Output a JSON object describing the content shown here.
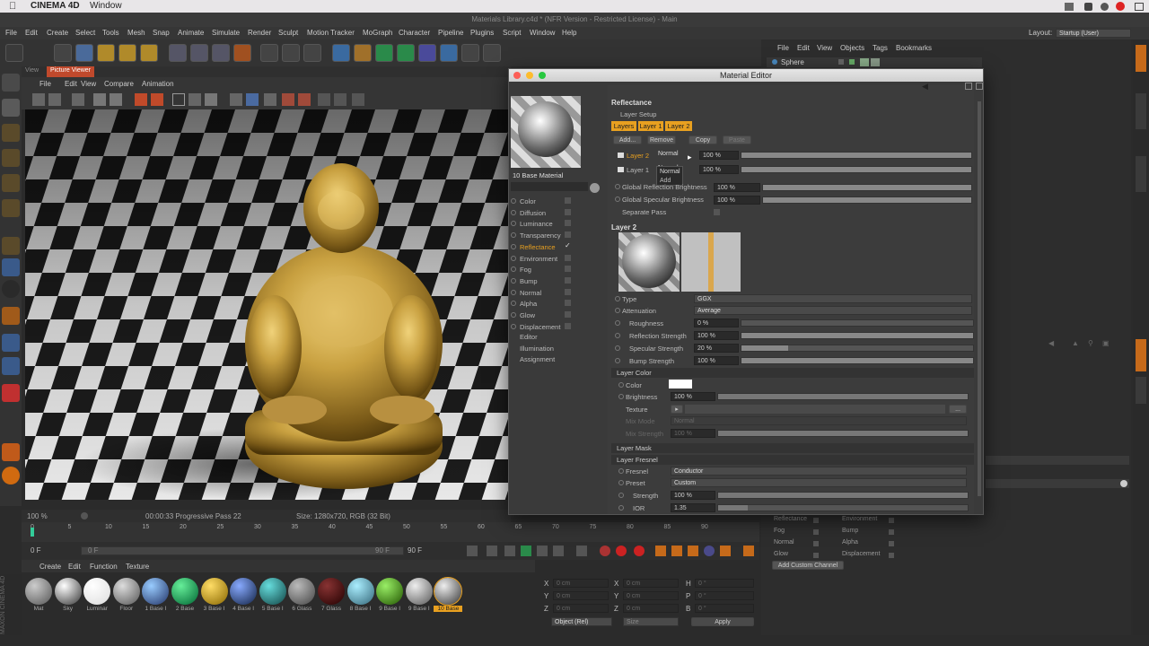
{
  "mac": {
    "app": "CINEMA 4D",
    "menu_window": "Window"
  },
  "window": {
    "title": "Materials Library.c4d * (NFR Version - Restricted License) - Main"
  },
  "menubar": [
    "File",
    "Edit",
    "Create",
    "Select",
    "Tools",
    "Mesh",
    "Snap",
    "Animate",
    "Simulate",
    "Render",
    "Sculpt",
    "Motion Tracker",
    "MoGraph",
    "Character",
    "Pipeline",
    "Plugins",
    "Script",
    "Window",
    "Help"
  ],
  "layout": {
    "label": "Layout:",
    "value": "Startup (User)"
  },
  "viewer": {
    "tabs": [
      "View",
      "Picture Viewer"
    ],
    "menu": [
      "File",
      "Edit",
      "View",
      "Compare",
      "Animation"
    ],
    "zoom": "100 %",
    "status": "00:00:33 Progressive Pass 22",
    "size": "Size: 1280x720, RGB (32 Bit)"
  },
  "timeline": {
    "ticks": [
      "0",
      "5",
      "10",
      "15",
      "20",
      "25",
      "30",
      "35",
      "40",
      "45",
      "50",
      "55",
      "60",
      "65",
      "70",
      "75",
      "80",
      "85",
      "90"
    ],
    "start": "0 F",
    "current": "0 F",
    "end": "90 F",
    "end2": "90 F",
    "frame": "0 F"
  },
  "matmgr": {
    "menu": [
      "Create",
      "Edit",
      "Function",
      "Texture"
    ],
    "materials": [
      "Mat",
      "Sky",
      "Luminar",
      "Floor",
      "1 Base I",
      "2 Base",
      "3 Base I",
      "4 Base I",
      "5 Base I",
      "6 Glass",
      "7 Glass",
      "8 Base I",
      "9 Base I",
      "9 Base I",
      "10 Base"
    ]
  },
  "coords": {
    "x": "X",
    "y": "Y",
    "z": "Z",
    "xv": "0 cm",
    "h": "H",
    "p": "P",
    "b": "B",
    "deg": "0 °",
    "mode": "Object (Rel)",
    "size": "Size",
    "apply": "Apply"
  },
  "objmgr": {
    "menu": [
      "File",
      "Edit",
      "View",
      "Objects",
      "Tags",
      "Bookmarks"
    ],
    "object": "Sphere"
  },
  "attrmgr": {
    "channels_left": [
      "Reflectance",
      "Fog",
      "Normal",
      "Glow"
    ],
    "channels_right": [
      "Environment",
      "Bump",
      "Alpha",
      "Displacement"
    ],
    "add_channel": "Add Custom Channel"
  },
  "editor": {
    "title": "Material Editor",
    "material_name": "10 Base Material",
    "channels": [
      {
        "name": "Color",
        "active": false
      },
      {
        "name": "Diffusion",
        "active": false
      },
      {
        "name": "Luminance",
        "active": false
      },
      {
        "name": "Transparency",
        "active": false
      },
      {
        "name": "Reflectance",
        "active": true
      },
      {
        "name": "Environment",
        "active": false
      },
      {
        "name": "Fog",
        "active": false
      },
      {
        "name": "Bump",
        "active": false
      },
      {
        "name": "Normal",
        "active": false
      },
      {
        "name": "Alpha",
        "active": false
      },
      {
        "name": "Glow",
        "active": false
      },
      {
        "name": "Displacement",
        "active": false
      }
    ],
    "extra": [
      "Editor",
      "Illumination",
      "Assignment"
    ],
    "reflectance": {
      "header": "Reflectance",
      "layer_setup": "Layer Setup",
      "tabs": [
        "Layers",
        "Layer 1",
        "Layer 2"
      ],
      "buttons": [
        "Add...",
        "Remove",
        "Copy",
        "Paste"
      ],
      "layers": [
        {
          "name": "Layer 2",
          "mode": "Normal",
          "value": "100 %"
        },
        {
          "name": "Layer 1",
          "mode": "Normal",
          "value": "100 %"
        }
      ],
      "popup_item": "Add",
      "global_refl_label": "Global Reflection Brightness",
      "global_refl": "100 %",
      "global_spec_label": "Global Specular Brightness",
      "global_spec": "100 %",
      "separate_pass": "Separate Pass"
    },
    "layer2": {
      "header": "Layer 2",
      "type_label": "Type",
      "type": "GGX",
      "atten_label": "Attenuation",
      "atten": "Average",
      "rough_label": "Roughness",
      "rough": "0 %",
      "rough_f": 0,
      "reflstr_label": "Reflection Strength",
      "reflstr": "100 %",
      "reflstr_f": 1,
      "specstr_label": "Specular Strength",
      "specstr": "20 %",
      "specstr_f": 0.2,
      "bump_label": "Bump Strength",
      "bump": "100 %",
      "bump_f": 1,
      "color_sec": "Layer Color",
      "color_label": "Color",
      "bright_label": "Brightness",
      "bright": "100 %",
      "texture_label": "Texture",
      "mixmode_label": "Mix Mode",
      "mixmode": "Normal",
      "mixstr_label": "Mix Strength",
      "mixstr": "100 %",
      "mask_sec": "Layer Mask",
      "fresnel_sec": "Layer Fresnel",
      "fresnel_label": "Fresnel",
      "fresnel": "Conductor",
      "preset_label": "Preset",
      "preset": "Custom",
      "strength_label": "Strength",
      "strength": "100 %",
      "ior_label": "IOR",
      "ior": "1.35"
    }
  }
}
